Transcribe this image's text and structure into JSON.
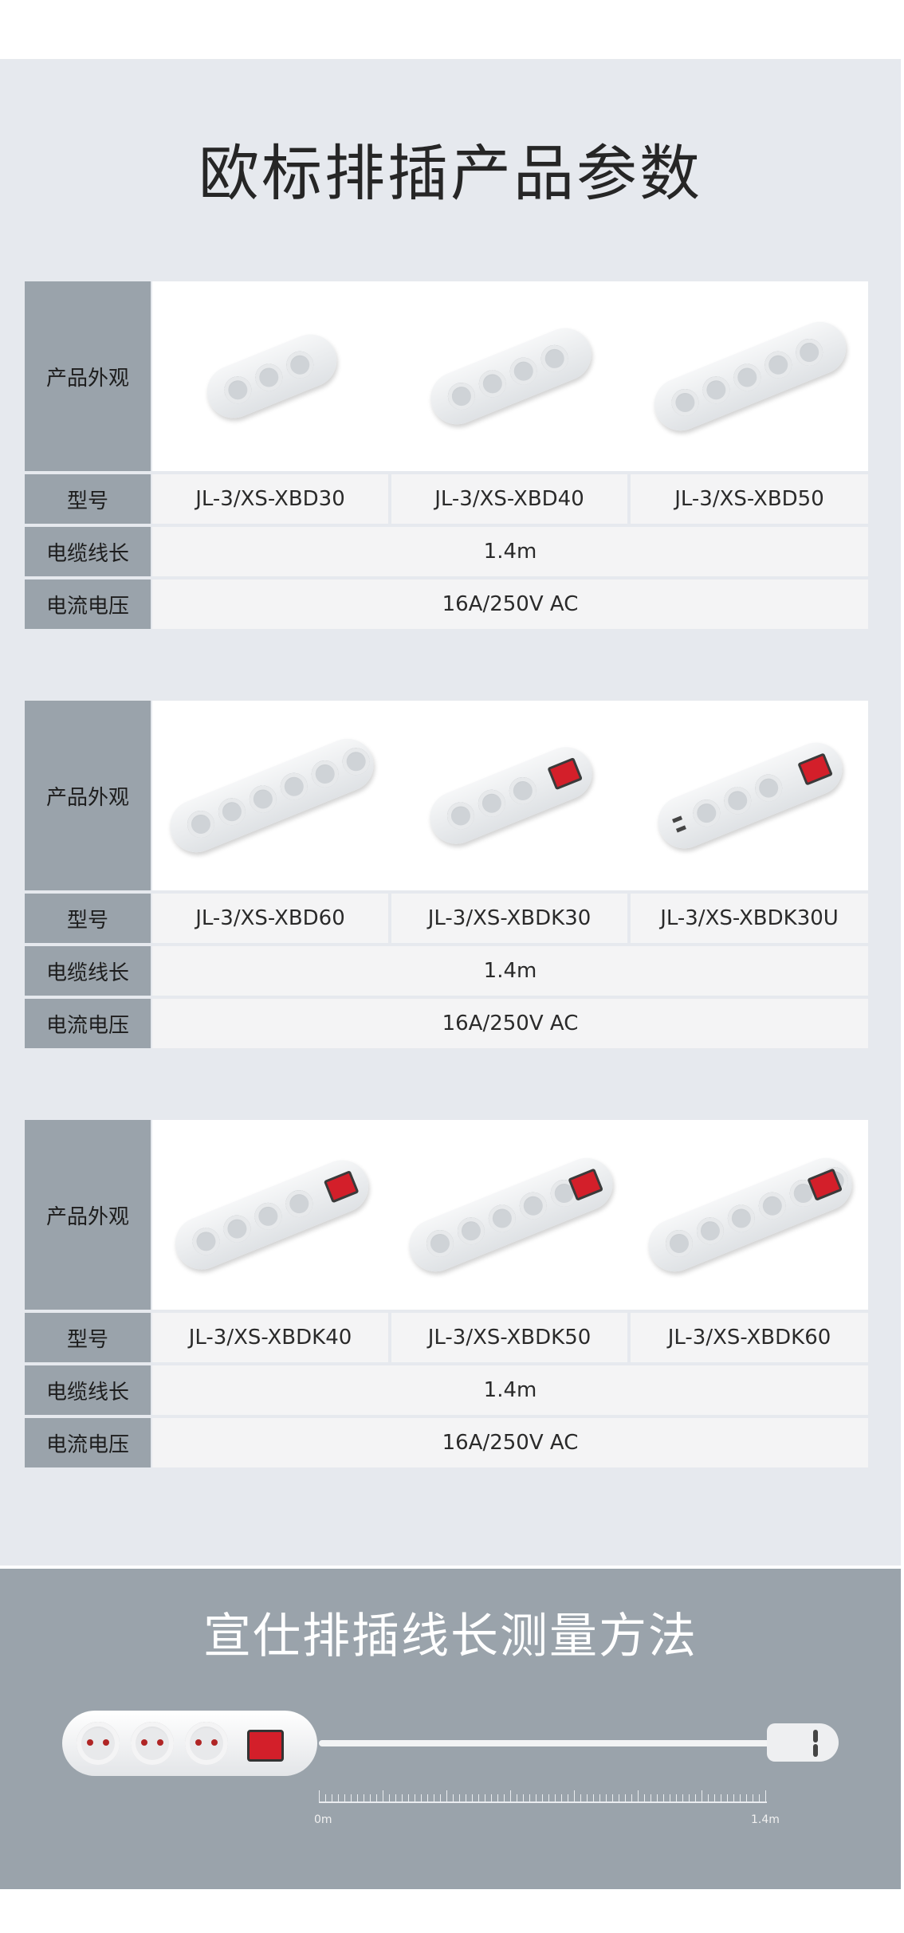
{
  "title": "欧标排插产品参数",
  "labels": {
    "appearance": "产品外观",
    "model": "型号",
    "cable_length": "电缆线长",
    "current_voltage": "电流电压"
  },
  "tables": [
    {
      "models": [
        "JL-3/XS-XBD30",
        "JL-3/XS-XBD40",
        "JL-3/XS-XBD50"
      ],
      "cable_length": "1.4m",
      "current_voltage": "16A/250V AC"
    },
    {
      "models": [
        "JL-3/XS-XBD60",
        "JL-3/XS-XBDK30",
        "JL-3/XS-XBDK30U"
      ],
      "cable_length": "1.4m",
      "current_voltage": "16A/250V AC"
    },
    {
      "models": [
        "JL-3/XS-XBDK40",
        "JL-3/XS-XBDK50",
        "JL-3/XS-XBDK60"
      ],
      "cable_length": "1.4m",
      "current_voltage": "16A/250V AC"
    }
  ],
  "product_images": [
    [
      {
        "sockets": 3,
        "switch": false,
        "usb": false
      },
      {
        "sockets": 4,
        "switch": false,
        "usb": false
      },
      {
        "sockets": 5,
        "switch": false,
        "usb": false
      }
    ],
    [
      {
        "sockets": 6,
        "switch": false,
        "usb": false
      },
      {
        "sockets": 3,
        "switch": true,
        "usb": false
      },
      {
        "sockets": 3,
        "switch": true,
        "usb": true
      }
    ],
    [
      {
        "sockets": 4,
        "switch": true,
        "usb": false
      },
      {
        "sockets": 5,
        "switch": true,
        "usb": false
      },
      {
        "sockets": 6,
        "switch": true,
        "usb": false
      }
    ]
  ],
  "measurement": {
    "title": "宣仕排插线长测量方法",
    "start_label": "0m",
    "end_label": "1.4m"
  },
  "colors": {
    "label_bg": "#9aa3ab",
    "section_bg": "#e6e9ee",
    "switch_red": "#d31f2a"
  }
}
